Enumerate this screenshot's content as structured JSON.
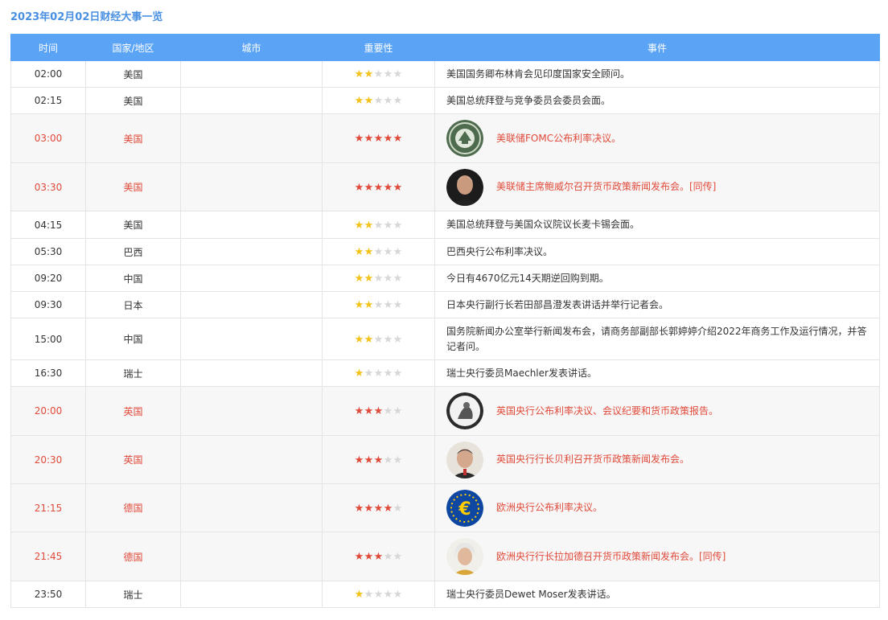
{
  "page": {
    "title": "2023年02月02日财经大事一览"
  },
  "table": {
    "headers": [
      "时间",
      "国家/地区",
      "城市",
      "重要性",
      "事件"
    ],
    "rows": [
      {
        "time": "02:00",
        "country": "美国",
        "city": "",
        "stars": 2,
        "event": "美国国务卿布林肯会见印度国家安全顾问。",
        "highlight": false,
        "icon": ""
      },
      {
        "time": "02:15",
        "country": "美国",
        "city": "",
        "stars": 2,
        "event": "美国总统拜登与竞争委员会委员会面。",
        "highlight": false,
        "icon": ""
      },
      {
        "time": "03:00",
        "country": "美国",
        "city": "",
        "stars": 5,
        "event": "美联储FOMC公布利率决议。",
        "highlight": true,
        "icon": "fed-seal-icon"
      },
      {
        "time": "03:30",
        "country": "美国",
        "city": "",
        "stars": 5,
        "event": "美联储主席鲍威尔召开货币政策新闻发布会。[同传]",
        "highlight": true,
        "icon": "powell-portrait-icon"
      },
      {
        "time": "04:15",
        "country": "美国",
        "city": "",
        "stars": 2,
        "event": "美国总统拜登与美国众议院议长麦卡锡会面。",
        "highlight": false,
        "icon": ""
      },
      {
        "time": "05:30",
        "country": "巴西",
        "city": "",
        "stars": 2,
        "event": "巴西央行公布利率决议。",
        "highlight": false,
        "icon": ""
      },
      {
        "time": "09:20",
        "country": "中国",
        "city": "",
        "stars": 2,
        "event": "今日有4670亿元14天期逆回购到期。",
        "highlight": false,
        "icon": ""
      },
      {
        "time": "09:30",
        "country": "日本",
        "city": "",
        "stars": 2,
        "event": "日本央行副行长若田部昌澄发表讲话并举行记者会。",
        "highlight": false,
        "icon": ""
      },
      {
        "time": "15:00",
        "country": "中国",
        "city": "",
        "stars": 2,
        "event": "国务院新闻办公室举行新闻发布会，请商务部副部长郭婷婷介绍2022年商务工作及运行情况，并答记者问。",
        "highlight": false,
        "icon": ""
      },
      {
        "time": "16:30",
        "country": "瑞士",
        "city": "",
        "stars": 1,
        "event": "瑞士央行委员Maechler发表讲话。",
        "highlight": false,
        "icon": ""
      },
      {
        "time": "20:00",
        "country": "英国",
        "city": "",
        "stars": 3,
        "event": "英国央行公布利率决议、会议纪要和货币政策报告。",
        "highlight": true,
        "icon": "boe-seal-icon"
      },
      {
        "time": "20:30",
        "country": "英国",
        "city": "",
        "stars": 3,
        "event": "英国央行行长贝利召开货币政策新闻发布会。",
        "highlight": true,
        "icon": "bailey-portrait-icon"
      },
      {
        "time": "21:15",
        "country": "德国",
        "city": "",
        "stars": 4,
        "event": "欧洲央行公布利率决议。",
        "highlight": true,
        "icon": "euro-logo-icon"
      },
      {
        "time": "21:45",
        "country": "德国",
        "city": "",
        "stars": 3,
        "event": "欧洲央行行长拉加德召开货币政策新闻发布会。[同传]",
        "highlight": true,
        "icon": "lagarde-portrait-icon"
      },
      {
        "time": "23:50",
        "country": "瑞士",
        "city": "",
        "stars": 1,
        "event": "瑞士央行委员Dewet Moser发表讲话。",
        "highlight": false,
        "icon": ""
      }
    ]
  },
  "colors": {
    "header_bg": "#5ba4f5",
    "title": "#4a90e2",
    "highlight_text": "#e04a3a",
    "star_on": "#f3c21b",
    "star_off": "#d7d7d7"
  }
}
